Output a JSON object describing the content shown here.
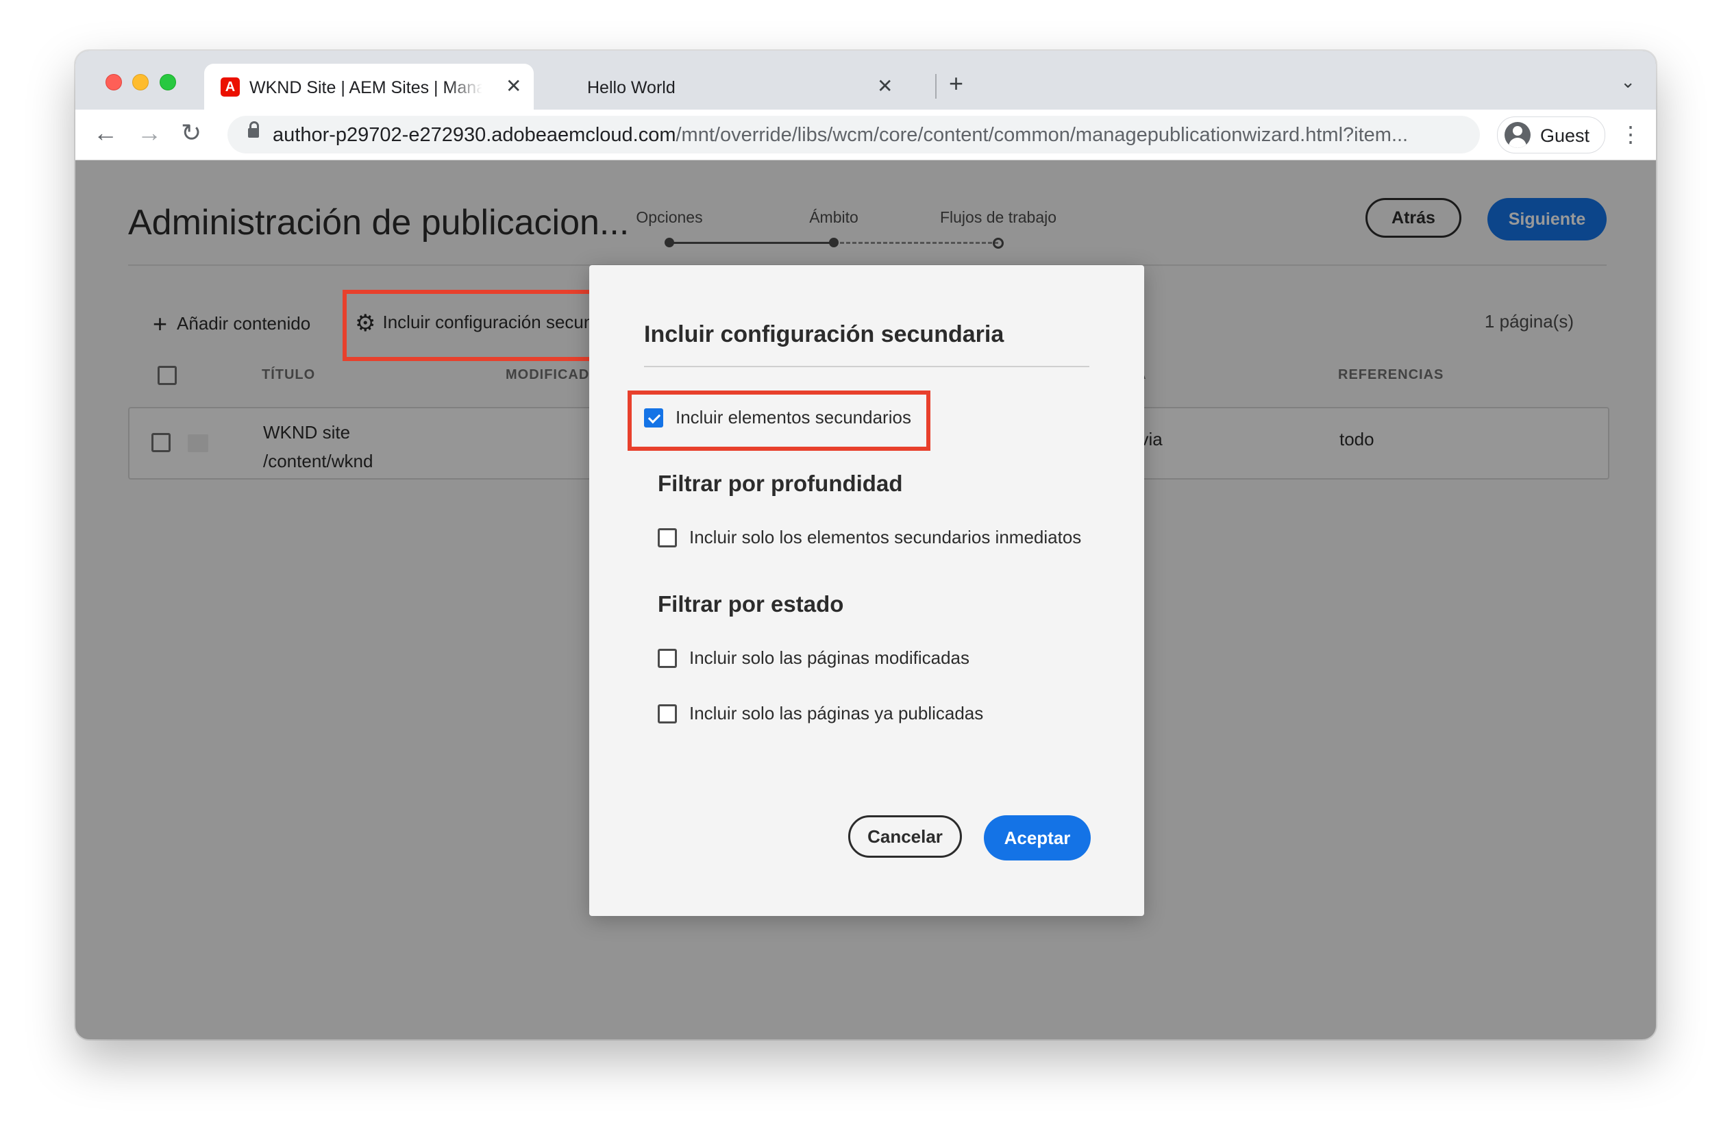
{
  "browser": {
    "tabs": [
      {
        "title": "WKND Site | AEM Sites | Manage Publication",
        "active": true
      },
      {
        "title": "Hello World",
        "active": false
      }
    ],
    "new_tab_label": "+",
    "tab_close_glyph": "✕",
    "url_host": "author-p29702-e272930.adobeaemcloud.com",
    "url_path": "/mnt/override/libs/wcm/core/content/common/managepublicationwizard.html?item...",
    "profile_label": "Guest",
    "nav": {
      "back": "←",
      "forward": "→",
      "reload": "↻",
      "menu": "⋮",
      "tab_list": "⌄"
    }
  },
  "page": {
    "title": "Administración de publicacion...",
    "steps": [
      {
        "label": "Opciones",
        "state": "done"
      },
      {
        "label": "Ámbito",
        "state": "current"
      },
      {
        "label": "Flujos de trabajo",
        "state": "todo"
      }
    ],
    "back_label": "Atrás",
    "next_label": "Siguiente",
    "add_content_label": "Añadir contenido",
    "include_config_label": "Incluir configuración secundaria",
    "page_count": "1 página(s)",
    "table": {
      "headers": {
        "title": "TÍTULO",
        "modified": "MODIFICADO",
        "hidden_col": "A",
        "references": "REFERENCIAS"
      },
      "rows": [
        {
          "title": "WKND site",
          "path": "/content/wknd",
          "hidden_value": "evia",
          "references": "todo"
        }
      ]
    }
  },
  "dialog": {
    "title": "Incluir configuración secundaria",
    "include_children_label": "Incluir elementos secundarios",
    "include_children_checked": true,
    "depth_heading": "Filtrar por profundidad",
    "depth_option_label": "Incluir solo los elementos secundarios inmediatos",
    "status_heading": "Filtrar por estado",
    "status_option_modified": "Incluir solo las páginas modificadas",
    "status_option_published": "Incluir solo las páginas ya publicadas",
    "cancel_label": "Cancelar",
    "ok_label": "Aceptar"
  },
  "colors": {
    "accent": "#1473e6",
    "callout": "#e8402c",
    "brand": "#eb1000"
  }
}
